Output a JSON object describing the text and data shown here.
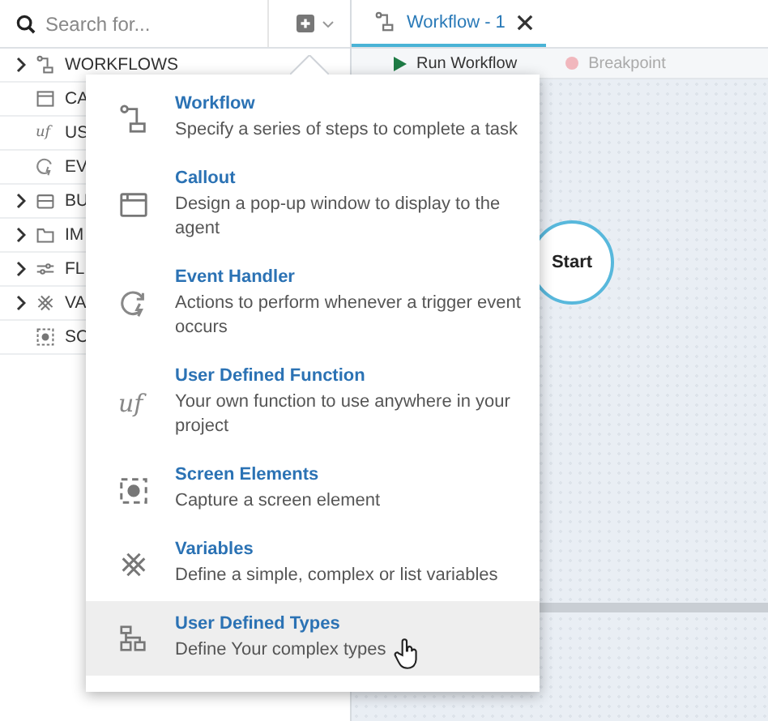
{
  "search": {
    "placeholder": "Search for..."
  },
  "sidebar": {
    "items": [
      {
        "label": "WORKFLOWS",
        "expandable": true
      },
      {
        "label": "CA",
        "expandable": false
      },
      {
        "label": "US",
        "expandable": false,
        "icon_text": "uf"
      },
      {
        "label": "EV",
        "expandable": false
      },
      {
        "label": "BU",
        "expandable": true
      },
      {
        "label": "IM",
        "expandable": true
      },
      {
        "label": "FL",
        "expandable": true
      },
      {
        "label": "VA",
        "expandable": true
      },
      {
        "label": "SC",
        "expandable": false
      }
    ]
  },
  "tabs": [
    {
      "label": "Workflow - 1",
      "selected": true
    }
  ],
  "toolbar": [
    {
      "label": "Run Workflow",
      "disabled": false
    },
    {
      "label": "Breakpoint",
      "disabled": true
    }
  ],
  "canvas": {
    "start_node": "Start"
  },
  "add_menu": {
    "items": [
      {
        "title": "Workflow",
        "description": "Specify a series of steps to complete a task",
        "selected": false
      },
      {
        "title": "Callout",
        "description": "Design a pop-up window to display to the agent",
        "selected": false
      },
      {
        "title": "Event Handler",
        "description": "Actions to perform whenever a trigger event occurs",
        "selected": false
      },
      {
        "title": "User Defined Function",
        "description": "Your own function to use anywhere in your project",
        "selected": false,
        "icon_text": "uf"
      },
      {
        "title": "Screen Elements",
        "description": "Capture a screen element",
        "selected": false
      },
      {
        "title": "Variables",
        "description": "Define a simple, complex or list variables",
        "selected": false
      },
      {
        "title": "User Defined Types",
        "description": "Define Your complex types",
        "selected": true
      }
    ]
  }
}
